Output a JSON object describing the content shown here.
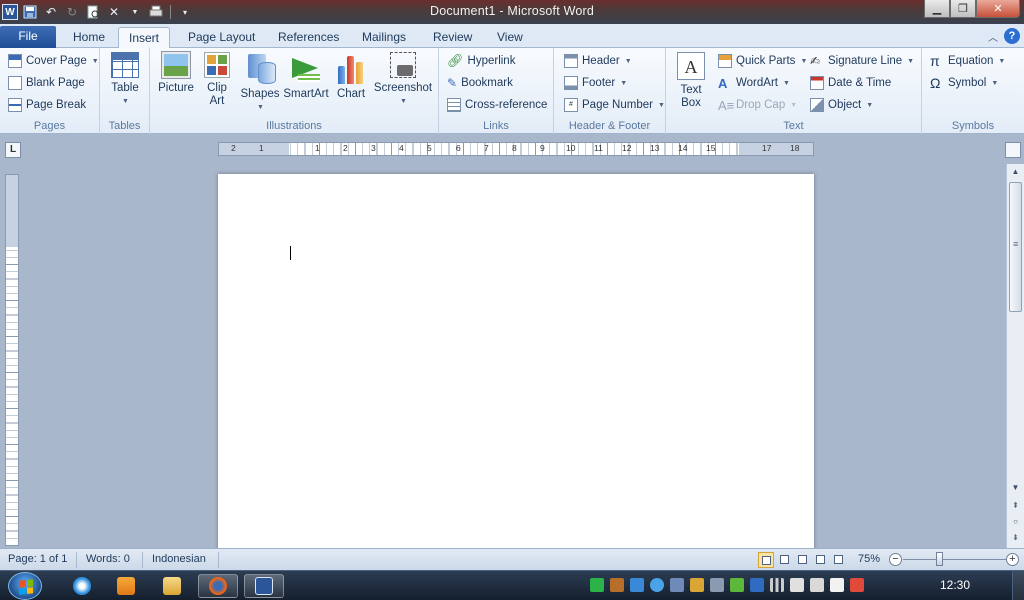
{
  "window": {
    "title": "Document1 - Microsoft Word"
  },
  "ribbon_tabs": [
    "File",
    "Home",
    "Insert",
    "Page Layout",
    "References",
    "Mailings",
    "Review",
    "View"
  ],
  "active_tab": "Insert",
  "groups": {
    "pages": {
      "label": "Pages",
      "cover_page": "Cover Page",
      "blank_page": "Blank Page",
      "page_break": "Page Break"
    },
    "tables": {
      "label": "Tables",
      "table": "Table"
    },
    "illustrations": {
      "label": "Illustrations",
      "picture": "Picture",
      "clip_art_1": "Clip",
      "clip_art_2": "Art",
      "shapes": "Shapes",
      "smartart": "SmartArt",
      "chart": "Chart",
      "screenshot": "Screenshot"
    },
    "links": {
      "label": "Links",
      "hyperlink": "Hyperlink",
      "bookmark": "Bookmark",
      "cross_reference": "Cross-reference"
    },
    "header_footer": {
      "label": "Header & Footer",
      "header": "Header",
      "footer": "Footer",
      "page_number": "Page Number"
    },
    "text": {
      "label": "Text",
      "text_box_1": "Text",
      "text_box_2": "Box",
      "quick_parts": "Quick Parts",
      "wordart": "WordArt",
      "drop_cap": "Drop Cap",
      "signature_line": "Signature Line",
      "date_time": "Date & Time",
      "object": "Object"
    },
    "symbols": {
      "label": "Symbols",
      "equation": "Equation",
      "symbol": "Symbol"
    }
  },
  "ruler": {
    "h_numbers": [
      "2",
      "1",
      "1",
      "2",
      "3",
      "4",
      "5",
      "6",
      "7",
      "8",
      "9",
      "10",
      "11",
      "12",
      "13",
      "14",
      "15",
      "17",
      "18"
    ]
  },
  "status": {
    "page": "Page: 1 of 1",
    "words": "Words: 0",
    "language": "Indonesian",
    "zoom": "75%"
  },
  "taskbar": {
    "clock": "12:30"
  },
  "icons": {
    "minimize": "minimize-icon",
    "maximize": "maximize-icon",
    "close": "close-icon",
    "help": "help-icon"
  }
}
